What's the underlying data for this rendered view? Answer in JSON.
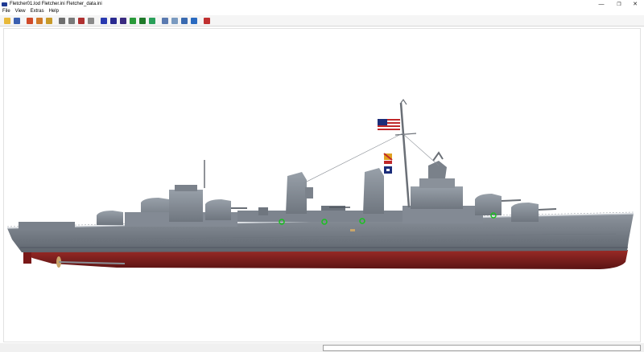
{
  "window": {
    "title": "Fletcher01.lod  Fletcher.ini  Fletcher_data.ini",
    "minimize_icon": "minimize-icon",
    "maximize_icon": "restore-icon",
    "close_icon": "close-icon"
  },
  "menu": {
    "items": [
      "File",
      "View",
      "Extras",
      "Help"
    ]
  },
  "toolbar": {
    "buttons": [
      {
        "icon": "open-folder-icon",
        "color": "#e8b93a"
      },
      {
        "icon": "save-icon",
        "color": "#3a5fb0"
      },
      {
        "icon": "rotate-x-icon",
        "color": "#d04a2a"
      },
      {
        "icon": "rotate-y-icon",
        "color": "#d07a2a"
      },
      {
        "icon": "rotate-z-icon",
        "color": "#c89a2a"
      },
      {
        "icon": "view-grey-1-icon",
        "color": "#6e6e6e"
      },
      {
        "icon": "view-grey-2-icon",
        "color": "#7a7a7a"
      },
      {
        "icon": "view-red-icon",
        "color": "#b03030"
      },
      {
        "icon": "view-grey-3-icon",
        "color": "#8a8a8a"
      },
      {
        "icon": "view-blue-1-icon",
        "color": "#2a3ab0"
      },
      {
        "icon": "view-blue-2-icon",
        "color": "#2a2a90"
      },
      {
        "icon": "view-blue-3-icon",
        "color": "#3a2a80"
      },
      {
        "icon": "view-green-1-icon",
        "color": "#2a9a3a"
      },
      {
        "icon": "view-green-2-icon",
        "color": "#1f7a2a"
      },
      {
        "icon": "view-green-3-icon",
        "color": "#2aa05a"
      },
      {
        "icon": "layer-1-icon",
        "color": "#5a7ab0"
      },
      {
        "icon": "layer-2-icon",
        "color": "#7a9ac0"
      },
      {
        "icon": "axis-icon",
        "color": "#3a6ab0"
      },
      {
        "icon": "box-icon",
        "color": "#2a6ac0"
      },
      {
        "icon": "tools-icon",
        "color": "#c03030"
      }
    ]
  },
  "colors": {
    "hull_grey": "#7d848e",
    "hull_dark": "#5c636c",
    "boot_red": "#8a1e1e",
    "superstructure": "#8a9099",
    "mast": "#6a6f76",
    "flag_red": "#c0282a",
    "flag_blue": "#1b2d7a",
    "light_green": "#19c21f"
  },
  "status": {
    "text": ""
  }
}
